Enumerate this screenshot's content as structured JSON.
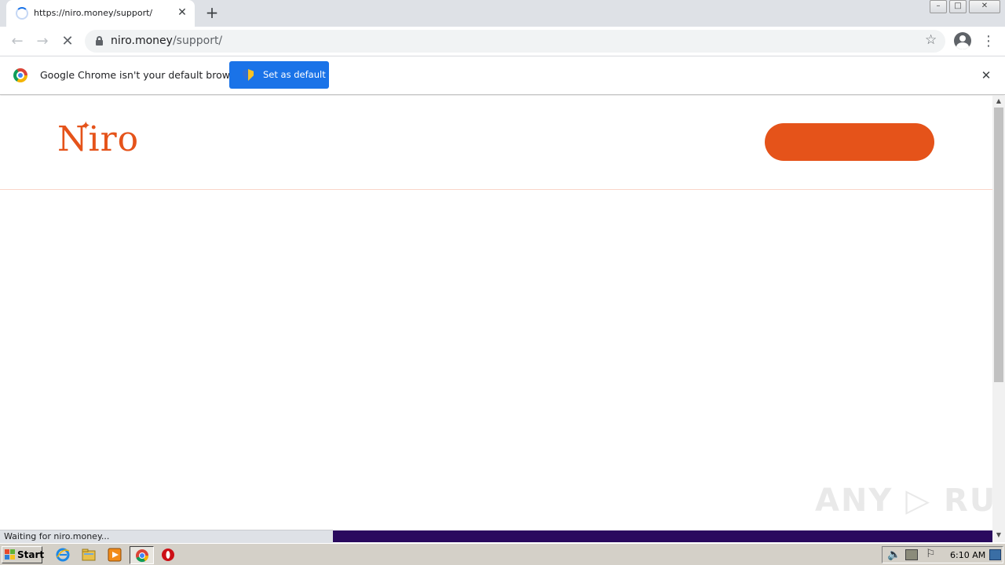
{
  "browser": {
    "tab": {
      "title": "https://niro.money/support/",
      "close_symbol": "✕"
    },
    "new_tab_symbol": "+",
    "window_controls": {
      "minimize": "–",
      "maximize": "□",
      "close": "✕"
    },
    "toolbar": {
      "back_symbol": "←",
      "forward_symbol": "→",
      "stop_symbol": "✕",
      "url_host": "niro.money",
      "url_path": "/support/",
      "star_symbol": "☆",
      "menu_symbol": "⋮"
    },
    "infobar": {
      "message": "Google Chrome isn't your default browser",
      "button_label": "Set as default",
      "close_symbol": "✕"
    },
    "status_text": "Waiting for niro.money...",
    "scroll_up_symbol": "▲",
    "scroll_down_symbol": "▼"
  },
  "page": {
    "logo_text": "Niro",
    "logo_sparkle": "✦",
    "cta_label": "",
    "watermark": "ANY ▷ RUN",
    "colors": {
      "brand": "#e5531a",
      "load_bar": "#2a0a5e",
      "chrome_button": "#1a73e8"
    }
  },
  "taskbar": {
    "start_label": "Start",
    "clock": "6:10 AM",
    "sound_symbol": "🔈",
    "flag_symbol": "⚐",
    "icons": [
      "internet-explorer-icon",
      "file-explorer-icon",
      "media-player-icon",
      "chrome-icon",
      "opera-icon"
    ]
  }
}
